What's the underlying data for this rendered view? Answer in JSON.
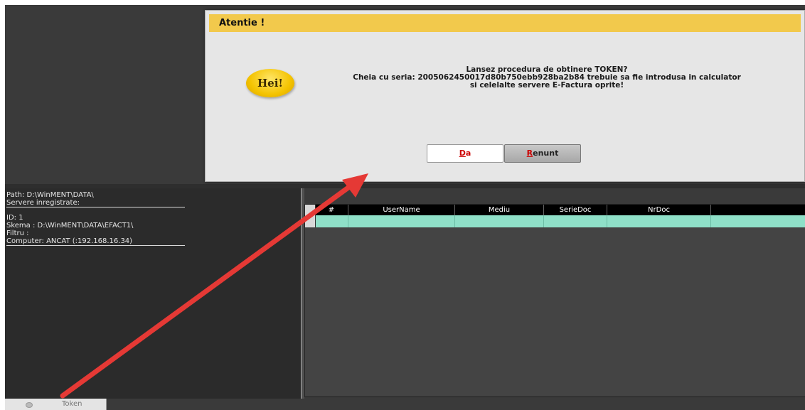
{
  "dialog": {
    "title": "Atentie !",
    "badge": "Hei!",
    "message_line1": "Lansez procedura de obtinere TOKEN?",
    "message_line2": "Cheia cu seria: 2005062450017d80b750ebb928ba2b84 trebuie sa fie introdusa in calculator",
    "message_line3": "si celelalte servere E-Factura oprite!",
    "btn_da_key": "D",
    "btn_da_rest": "a",
    "btn_renunt_key": "R",
    "btn_renunt_rest": "enunt"
  },
  "info": {
    "path": "Path: D:\\WinMENT\\DATA\\",
    "servers": "Servere inregistrate:",
    "id": "ID: 1",
    "schema": "Skema  : D:\\WinMENT\\DATA\\EFACT1\\",
    "filter": "Filtru  :",
    "computer": "Computer: ANCAT (:192.168.16.34)"
  },
  "grid": {
    "columns": [
      "#",
      "UserName",
      "Mediu",
      "SerieDoc",
      "NrDoc",
      ""
    ]
  },
  "statusbar": {
    "token_tab": "Token"
  },
  "colors": {
    "title_bar": "#f2c94c",
    "row_selected": "#8fe0c8",
    "annotation_arrow": "#e53935"
  }
}
